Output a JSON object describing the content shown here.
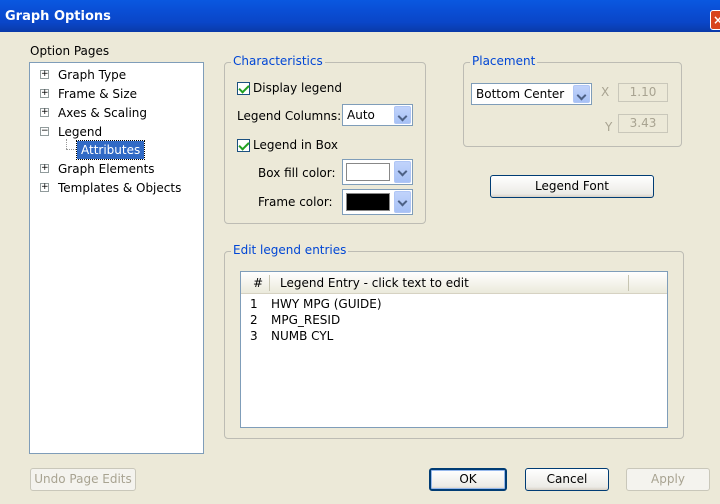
{
  "window": {
    "title": "Graph Options",
    "close_glyph": "×"
  },
  "option_pages": {
    "label": "Option Pages",
    "items": [
      {
        "label": "Graph Type",
        "expander": "+"
      },
      {
        "label": "Frame & Size",
        "expander": "+"
      },
      {
        "label": "Axes & Scaling",
        "expander": "+"
      },
      {
        "label": "Legend",
        "expander": "−"
      },
      {
        "label": "Attributes",
        "selected": true
      },
      {
        "label": "Graph Elements",
        "expander": "+"
      },
      {
        "label": "Templates & Objects",
        "expander": "+"
      }
    ]
  },
  "characteristics": {
    "title": "Characteristics",
    "display_legend": {
      "label": "Display legend",
      "checked": true
    },
    "legend_columns": {
      "label": "Legend Columns:",
      "value": "Auto"
    },
    "legend_in_box": {
      "label": "Legend in Box",
      "checked": true
    },
    "box_fill_color": {
      "label": "Box fill color:",
      "color": "#ffffff"
    },
    "frame_color": {
      "label": "Frame color:",
      "color": "#000000"
    }
  },
  "placement": {
    "title": "Placement",
    "position": "Bottom Center",
    "x_label": "X",
    "x_value": "1.10",
    "y_label": "Y",
    "y_value": "3.43"
  },
  "legend_font_button": "Legend Font",
  "edit_entries": {
    "title": "Edit legend entries",
    "col_num": "#",
    "col_entry": "Legend Entry -  click text to edit",
    "rows": [
      {
        "num": "1",
        "entry": "HWY MPG (GUIDE)"
      },
      {
        "num": "2",
        "entry": "MPG_RESID"
      },
      {
        "num": "3",
        "entry": "NUMB CYL"
      }
    ]
  },
  "buttons": {
    "undo": "Undo Page Edits",
    "ok": "OK",
    "cancel": "Cancel",
    "apply": "Apply"
  }
}
